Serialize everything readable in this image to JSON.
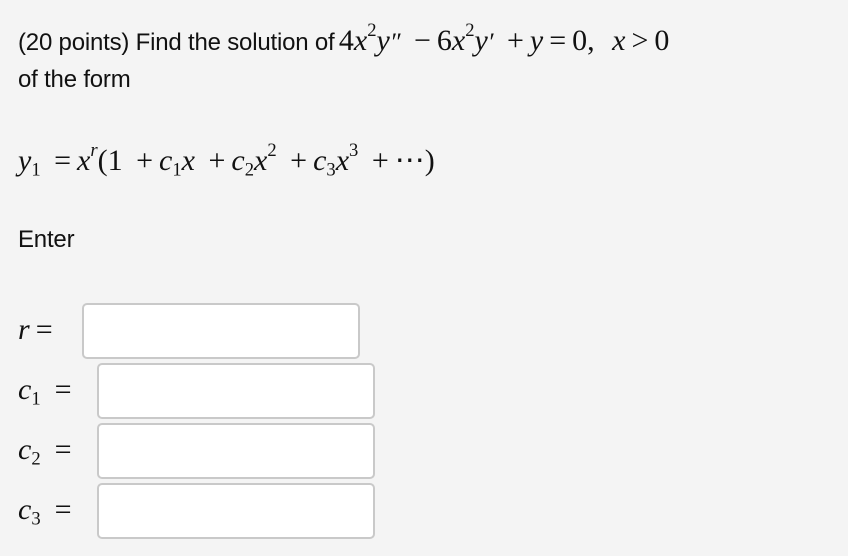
{
  "question": {
    "prefix": "(20 points) Find the solution of",
    "equation": {
      "coef1": "4",
      "var_x": "x",
      "exp2": "2",
      "var_y": "y",
      "double_prime": "″",
      "minus": "−",
      "coef2": "6",
      "prime": "′",
      "plus": "+",
      "equals": "=",
      "zero": "0",
      "comma": ",",
      "gt": ">"
    },
    "line2": "of the form"
  },
  "formula": {
    "y": "y",
    "sub1": "1",
    "equals": "=",
    "x": "x",
    "r": "r",
    "open": "(1",
    "plus": "+",
    "c": "c",
    "sub2": "2",
    "sub3": "3",
    "exp2": "2",
    "exp3": "3",
    "ellipsis": "⋯",
    "close": ")"
  },
  "enter_label": "Enter",
  "answers": [
    {
      "var": "r",
      "sub": "",
      "equals": "=",
      "value": "",
      "placeholder": ""
    },
    {
      "var": "c",
      "sub": "1",
      "equals": "=",
      "value": "",
      "placeholder": ""
    },
    {
      "var": "c",
      "sub": "2",
      "equals": "=",
      "value": "",
      "placeholder": ""
    },
    {
      "var": "c",
      "sub": "3",
      "equals": "=",
      "value": "",
      "placeholder": ""
    }
  ]
}
